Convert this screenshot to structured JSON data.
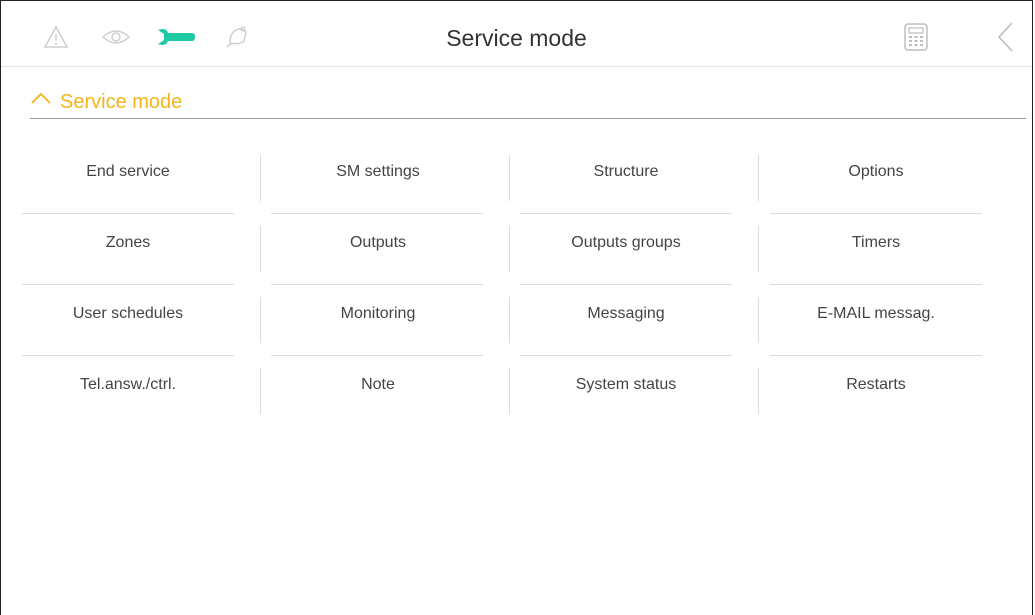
{
  "header": {
    "title": "Service mode",
    "icons": [
      "warning-icon",
      "eye-icon",
      "wrench-icon",
      "bell-icon",
      "calculator-icon",
      "back-icon"
    ],
    "accent_color": "#1ec9a4"
  },
  "section": {
    "label": "Service mode",
    "color": "#f3b41b"
  },
  "menu": {
    "items": [
      "End service",
      "SM settings",
      "Structure",
      "Options",
      "Zones",
      "Outputs",
      "Outputs groups",
      "Timers",
      "User schedules",
      "Monitoring",
      "Messaging",
      "E-MAIL messag.",
      "Tel.answ./ctrl.",
      "Note",
      "System status",
      "Restarts"
    ]
  }
}
